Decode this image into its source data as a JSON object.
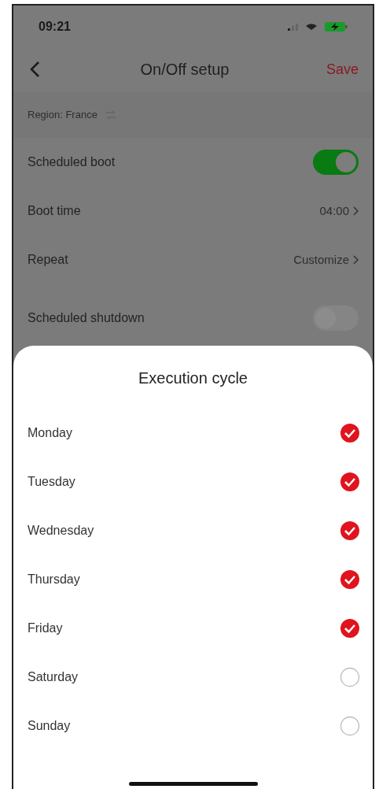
{
  "status_bar": {
    "time": "09:21"
  },
  "nav": {
    "title": "On/Off setup",
    "save": "Save"
  },
  "region": {
    "label": "Region: France"
  },
  "settings": [
    {
      "kind": "toggle",
      "label": "Scheduled boot",
      "on": true
    },
    {
      "kind": "value",
      "label": "Boot time",
      "value": "04:00"
    },
    {
      "kind": "value",
      "label": "Repeat",
      "value": "Customize"
    },
    {
      "kind": "toggle",
      "label": "Scheduled shutdown",
      "on": false
    }
  ],
  "sheet": {
    "title": "Execution cycle",
    "days": [
      {
        "label": "Monday",
        "checked": true
      },
      {
        "label": "Tuesday",
        "checked": true
      },
      {
        "label": "Wednesday",
        "checked": true
      },
      {
        "label": "Thursday",
        "checked": true
      },
      {
        "label": "Friday",
        "checked": true
      },
      {
        "label": "Saturday",
        "checked": false
      },
      {
        "label": "Sunday",
        "checked": false
      }
    ]
  }
}
